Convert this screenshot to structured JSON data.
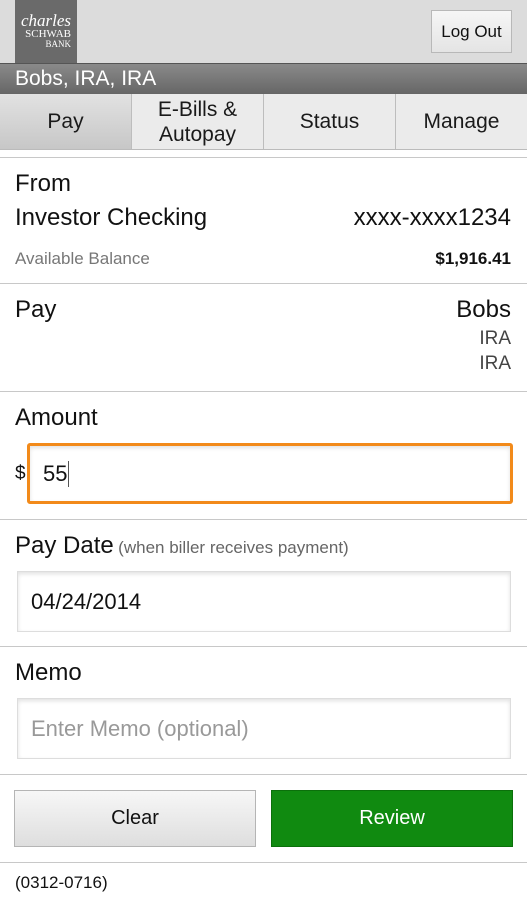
{
  "logo": {
    "line1": "charles",
    "line2": "SCHWAB",
    "line3": "BANK"
  },
  "header": {
    "logout_label": "Log Out",
    "title": "Bobs, IRA, IRA"
  },
  "tabs": [
    {
      "label": "Pay"
    },
    {
      "label": "E-Bills &\nAutopay"
    },
    {
      "label": "Status"
    },
    {
      "label": "Manage"
    }
  ],
  "from": {
    "label": "From",
    "account": "Investor Checking",
    "account_number": "xxxx-xxxx1234",
    "balance_label": "Available Balance",
    "balance": "$1,916.41"
  },
  "pay": {
    "label": "Pay",
    "payee_line1": "Bobs",
    "payee_line2": "IRA",
    "payee_line3": "IRA"
  },
  "amount": {
    "label": "Amount",
    "currency": "$",
    "value": "55"
  },
  "pay_date": {
    "label": "Pay Date",
    "hint": "(when biller receives payment)",
    "value": "04/24/2014"
  },
  "memo": {
    "label": "Memo",
    "placeholder": "Enter Memo (optional)",
    "value": ""
  },
  "actions": {
    "clear_label": "Clear",
    "review_label": "Review"
  },
  "footer": {
    "code": "(0312-0716)"
  },
  "colors": {
    "accent_focus": "#f28a1a",
    "review": "#108a10"
  }
}
